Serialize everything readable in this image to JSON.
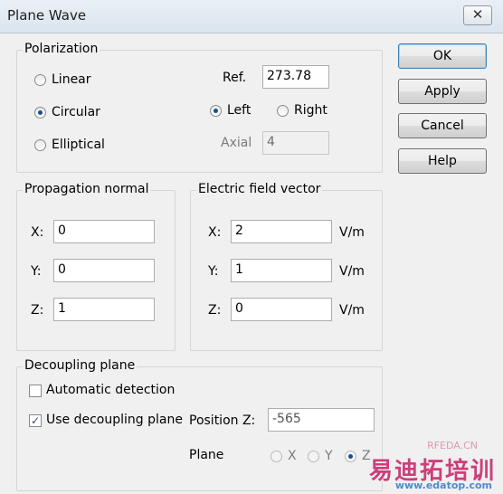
{
  "window": {
    "title": "Plane Wave",
    "close_glyph": "✕"
  },
  "buttons": {
    "ok": "OK",
    "apply": "Apply",
    "cancel": "Cancel",
    "help": "Help"
  },
  "polarization": {
    "label": "Polarization",
    "options": [
      "Linear",
      "Circular",
      "Elliptical"
    ],
    "selected": "Circular",
    "ref_label": "Ref.",
    "ref_value": "273.78",
    "handedness": [
      "Left",
      "Right"
    ],
    "handedness_selected": "Left",
    "axial_label": "Axial",
    "axial_value": "4"
  },
  "propagation": {
    "label": "Propagation normal",
    "x_label": "X:",
    "x": "0",
    "y_label": "Y:",
    "y": "0",
    "z_label": "Z:",
    "z": "1"
  },
  "efield": {
    "label": "Electric field vector",
    "x_label": "X:",
    "x": "2",
    "y_label": "Y:",
    "y": "1",
    "z_label": "Z:",
    "z": "0",
    "unit": "V/m"
  },
  "decoupling": {
    "label": "Decoupling plane",
    "auto_label": "Automatic detection",
    "auto_checked": false,
    "use_label": "Use decoupling plane",
    "use_checked": true,
    "position_label": "Position Z:",
    "position_value": "-565",
    "plane_label": "Plane",
    "plane_options": [
      "X",
      "Y",
      "Z"
    ],
    "plane_selected": "Z"
  },
  "watermark": {
    "brand": "易迪拓培训",
    "url": "www.edatop.com",
    "site": "RFEDA.CN"
  }
}
